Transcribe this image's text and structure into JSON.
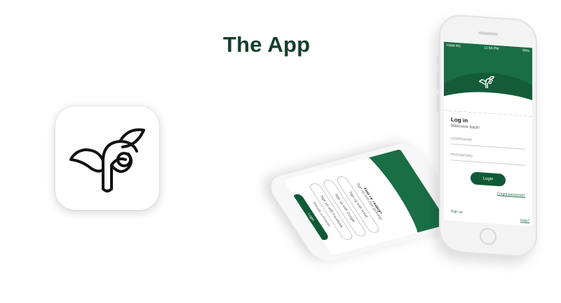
{
  "header": {
    "title": "The App"
  },
  "icons": {
    "app_logo": "leaf-p-logo-icon"
  },
  "colors": {
    "brand_dark": "#123f2a",
    "brand_green": "#1a6e45",
    "button_green": "#0f5a36"
  },
  "phone_login": {
    "status_carrier": "Hotel 4G",
    "status_time": "11:56 PM",
    "status_battery": "90%",
    "heading": "Log in",
    "subheading": "Welcome back!",
    "username_placeholder": "USERNAME",
    "password_placeholder": "PASSWORD",
    "login_button": "Login",
    "forgot_password": "Forgot password?",
    "signup_link": "Sign up",
    "help_link": "Help?"
  },
  "phone_signup": {
    "heading": "You're ready!",
    "subheading": "Sign up and start growing!",
    "options": [
      "Sign up with email",
      "Sign up with Google",
      "Sign up with Facebook"
    ],
    "already_text": "Already a Grower",
    "login_button": "Login",
    "help_link": "Help?"
  }
}
